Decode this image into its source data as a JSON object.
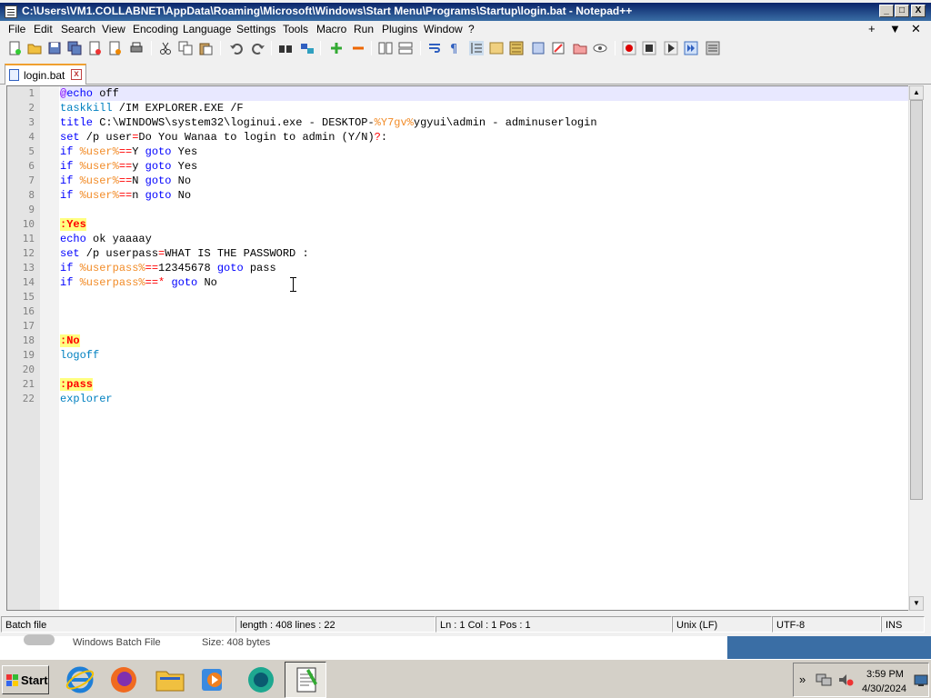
{
  "window": {
    "title": "C:\\Users\\VM1.COLLABNET\\AppData\\Roaming\\Microsoft\\Windows\\Start Menu\\Programs\\Startup\\login.bat - Notepad++",
    "min": "_",
    "max": "□",
    "close": "X"
  },
  "menu": {
    "items": [
      "File",
      "Edit",
      "Search",
      "View",
      "Encoding",
      "Language",
      "Settings",
      "Tools",
      "Macro",
      "Run",
      "Plugins",
      "Window",
      "?"
    ],
    "right": [
      "+",
      "▼",
      "✕"
    ]
  },
  "tab": {
    "label": "login.bat",
    "close": "x"
  },
  "editor": {
    "line_numbers": [
      "1",
      "2",
      "3",
      "4",
      "5",
      "6",
      "7",
      "8",
      "9",
      "10",
      "11",
      "12",
      "13",
      "14",
      "15",
      "16",
      "17",
      "18",
      "19",
      "20",
      "21",
      "22"
    ],
    "lines": {
      "l1": [
        "@",
        "echo",
        " off"
      ],
      "l2": [
        "taskkill",
        " /IM EXPLORER.EXE /F"
      ],
      "l3": [
        "title",
        " C:\\WINDOWS\\system32\\loginui.exe - DESKTOP-",
        "%Y7gv%",
        "ygyui\\admin - adminuserlogin"
      ],
      "l4": [
        "set",
        " /p user",
        "=",
        "Do You Wanaa to login to admin (Y/N)",
        "?",
        ":"
      ],
      "l5": [
        "if",
        " ",
        "%user%",
        "==",
        "Y ",
        "goto",
        " Yes"
      ],
      "l6": [
        "if",
        " ",
        "%user%",
        "==",
        "y ",
        "goto",
        " Yes"
      ],
      "l7": [
        "if",
        " ",
        "%user%",
        "==",
        "N ",
        "goto",
        " No"
      ],
      "l8": [
        "if",
        " ",
        "%user%",
        "==",
        "n ",
        "goto",
        " No"
      ],
      "l10": ":Yes",
      "l11": [
        "echo",
        " ok yaaaay"
      ],
      "l12": [
        "set",
        " /p userpass",
        "=",
        "WHAT IS THE PASSWORD :"
      ],
      "l13": [
        "if",
        " ",
        "%userpass%",
        "==",
        "12345678 ",
        "goto",
        " pass"
      ],
      "l14": [
        "if",
        " ",
        "%userpass%",
        "==",
        "* ",
        "goto",
        " No"
      ],
      "l18": ":No",
      "l19": "logoff",
      "l21": ":pass",
      "l22": "explorer"
    }
  },
  "status": {
    "type": "Batch file",
    "length": "length : 408    lines : 22",
    "pos": "Ln : 1    Col : 1    Pos : 1",
    "eol": "Unix (LF)",
    "enc": "UTF-8",
    "ins": "INS"
  },
  "behind": {
    "file_type": "Windows Batch File",
    "size": "Size: 408 bytes"
  },
  "taskbar": {
    "start": "Start",
    "time": "3:59 PM",
    "date": "4/30/2024",
    "tray_arrow": "»"
  },
  "colors": {
    "keyword": "#0000ff",
    "variable": "#f28c28",
    "operator": "#ff0000",
    "label_bg": "#ffff80",
    "title_bar": "#0a246a"
  }
}
